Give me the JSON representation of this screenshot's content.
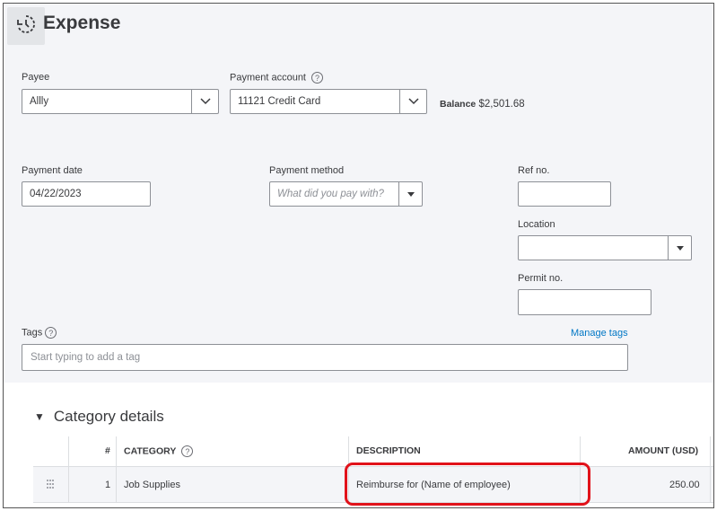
{
  "header": {
    "title": "Expense",
    "history_icon": "history-clock-icon"
  },
  "payee": {
    "label": "Payee",
    "value": "Allly"
  },
  "payment_account": {
    "label": "Payment account",
    "value": "11121 Credit Card",
    "help": "?"
  },
  "balance": {
    "label": "Balance",
    "value": "$2,501.68"
  },
  "payment_date": {
    "label": "Payment date",
    "value": "04/22/2023"
  },
  "payment_method": {
    "label": "Payment method",
    "placeholder": "What did you pay with?"
  },
  "ref_no": {
    "label": "Ref no.",
    "value": ""
  },
  "location": {
    "label": "Location",
    "value": ""
  },
  "permit_no": {
    "label": "Permit no.",
    "value": ""
  },
  "tags": {
    "label": "Tags",
    "help": "?",
    "manage_link": "Manage tags",
    "placeholder": "Start typing to add a tag"
  },
  "category_details": {
    "title": "Category details",
    "columns": {
      "num": "#",
      "category": "CATEGORY",
      "description": "DESCRIPTION",
      "amount": "AMOUNT (USD)"
    },
    "rows": [
      {
        "num": "1",
        "category": "Job Supplies",
        "description": "Reimburse for (Name of employee)",
        "amount": "250.00"
      }
    ]
  },
  "colors": {
    "accent_link": "#0077c5",
    "highlight": "#e1121a",
    "background": "#f4f5f8"
  }
}
